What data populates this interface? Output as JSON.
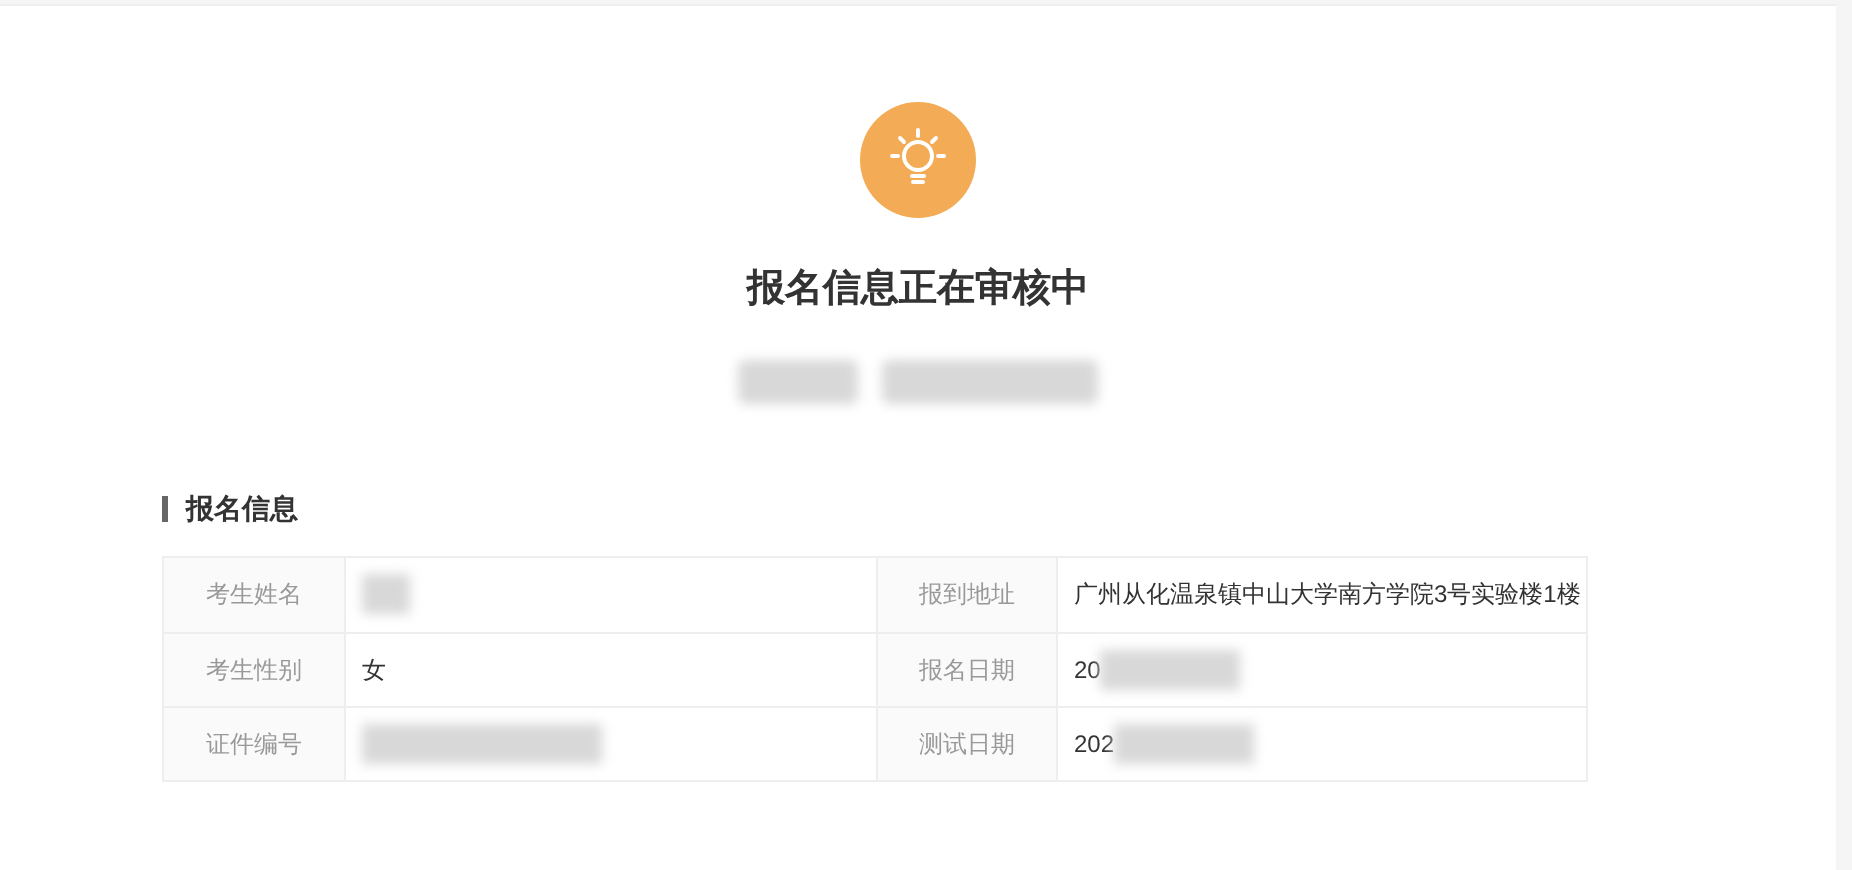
{
  "status": {
    "title": "报名信息正在审核中",
    "subtitle_redacted": true
  },
  "section": {
    "title": "报名信息"
  },
  "rows": [
    {
      "cells": [
        {
          "label": "考生姓名",
          "redacted": true
        },
        {
          "label": "报到地址",
          "value": "广州从化温泉镇中山大学南方学院3号实验楼1楼",
          "redacted": false
        }
      ]
    },
    {
      "cells": [
        {
          "label": "考生性别",
          "value": "女",
          "redacted": false
        },
        {
          "label": "报名日期",
          "value": "20",
          "redacted": true
        }
      ]
    },
    {
      "cells": [
        {
          "label": "证件编号",
          "redacted": true
        },
        {
          "label": "测试日期",
          "value": "202",
          "redacted": true
        }
      ]
    }
  ]
}
